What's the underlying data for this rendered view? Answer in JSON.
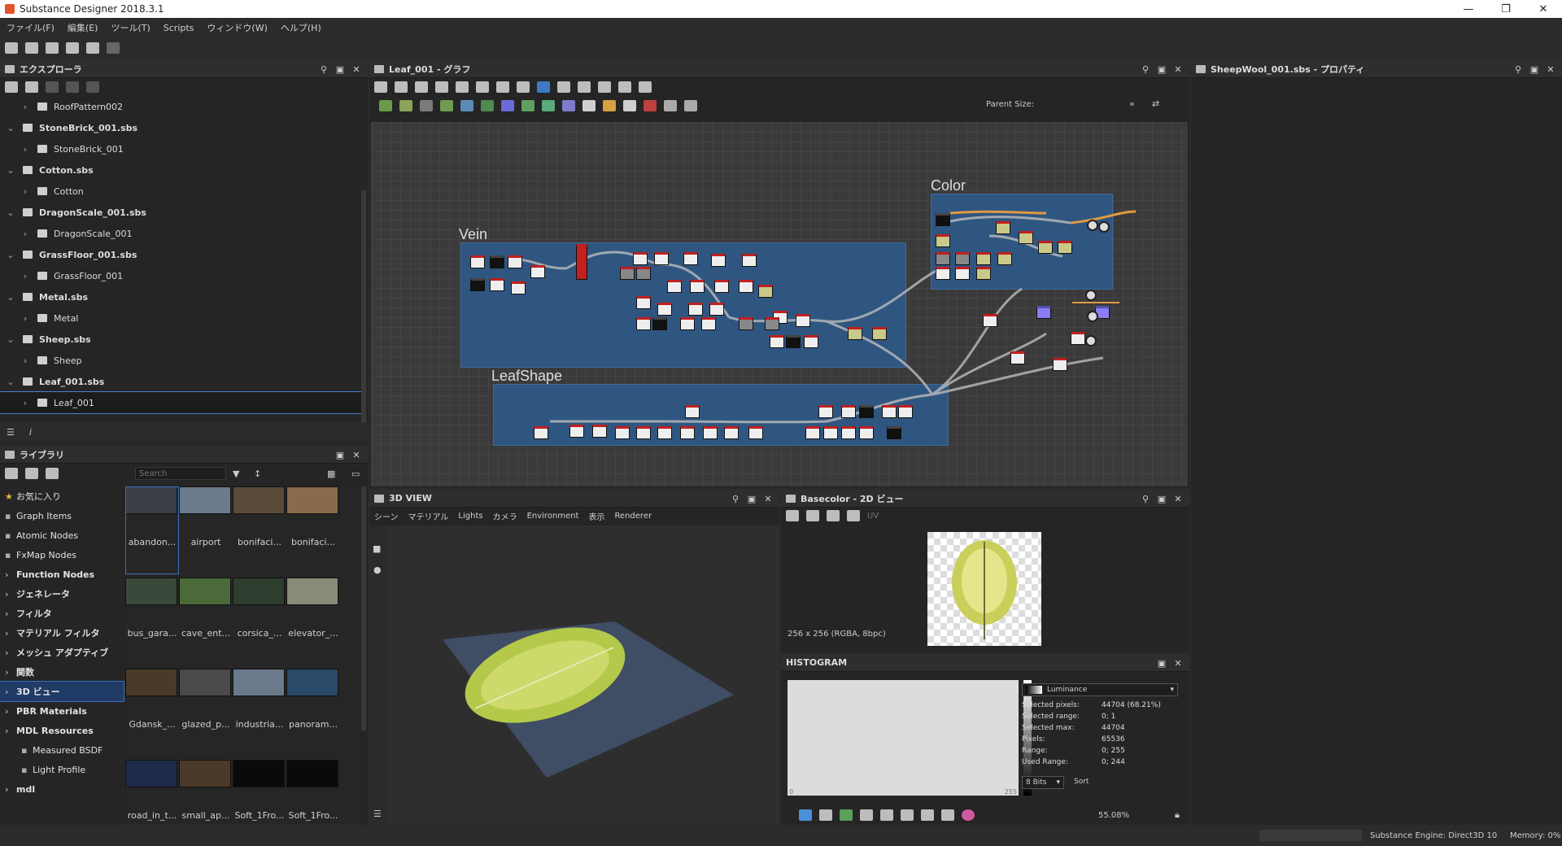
{
  "window": {
    "title": "Substance Designer 2018.3.1"
  },
  "menu": [
    "ファイル(F)",
    "編集(E)",
    "ツール(T)",
    "Scripts",
    "ウィンドウ(W)",
    "ヘルプ(H)"
  ],
  "explorer": {
    "title": "エクスプローラ",
    "rows": [
      {
        "label": "RoofPattern002",
        "level": 2,
        "expanded": false
      },
      {
        "label": "StoneBrick_001.sbs",
        "level": 1,
        "expanded": true
      },
      {
        "label": "StoneBrick_001",
        "level": 2,
        "expanded": false
      },
      {
        "label": "Cotton.sbs",
        "level": 1,
        "expanded": true
      },
      {
        "label": "Cotton",
        "level": 2,
        "expanded": false
      },
      {
        "label": "DragonScale_001.sbs",
        "level": 1,
        "expanded": true
      },
      {
        "label": "DragonScale_001",
        "level": 2,
        "expanded": false
      },
      {
        "label": "GrassFloor_001.sbs",
        "level": 1,
        "expanded": true
      },
      {
        "label": "GrassFloor_001",
        "level": 2,
        "expanded": false
      },
      {
        "label": "Metal.sbs",
        "level": 1,
        "expanded": true
      },
      {
        "label": "Metal",
        "level": 2,
        "expanded": false
      },
      {
        "label": "Sheep.sbs",
        "level": 1,
        "expanded": true
      },
      {
        "label": "Sheep",
        "level": 2,
        "expanded": false
      },
      {
        "label": "Leaf_001.sbs",
        "level": 1,
        "expanded": true
      },
      {
        "label": "Leaf_001",
        "level": 2,
        "expanded": false,
        "selected": true
      }
    ]
  },
  "library": {
    "title": "ライブラリ",
    "search_placeholder": "Search",
    "categories": [
      {
        "label": "お気に入り",
        "arrow": false,
        "bold": false
      },
      {
        "label": "Graph Items",
        "arrow": false,
        "bold": false
      },
      {
        "label": "Atomic Nodes",
        "arrow": false,
        "bold": false
      },
      {
        "label": "FxMap Nodes",
        "arrow": false,
        "bold": false
      },
      {
        "label": "Function Nodes",
        "arrow": true,
        "bold": true
      },
      {
        "label": "ジェネレータ",
        "arrow": true,
        "bold": true
      },
      {
        "label": "フィルタ",
        "arrow": true,
        "bold": true
      },
      {
        "label": "マテリアル フィルタ",
        "arrow": true,
        "bold": true
      },
      {
        "label": "メッシュ アダプティブ",
        "arrow": true,
        "bold": true
      },
      {
        "label": "関数",
        "arrow": true,
        "bold": true
      },
      {
        "label": "3D ビュー",
        "arrow": true,
        "bold": true,
        "selected": true
      },
      {
        "label": "PBR Materials",
        "arrow": true,
        "bold": true
      },
      {
        "label": "MDL Resources",
        "arrow": true,
        "bold": true
      },
      {
        "label": "Measured BSDF",
        "arrow": false,
        "bold": false,
        "indent": true
      },
      {
        "label": "Light Profile",
        "arrow": false,
        "bold": false,
        "indent": true
      },
      {
        "label": "mdl",
        "arrow": true,
        "bold": true
      }
    ],
    "thumbnails": [
      "abandon...",
      "airport",
      "bonifaci...",
      "bonifaci...",
      "bus_gara...",
      "cave_ent...",
      "corsica_...",
      "elevator_...",
      "Gdansk_...",
      "glazed_p...",
      "industria...",
      "panoram...",
      "road_in_t...",
      "small_ap...",
      "Soft_1Fro...",
      "Soft_1Fro..."
    ]
  },
  "graph": {
    "title": "Leaf_001 - グラフ",
    "parent_size_label": "Parent Size:",
    "frames": [
      "Vein",
      "LeafShape",
      "Color"
    ]
  },
  "properties": {
    "title": "SheepWool_001.sbs - プロパティ"
  },
  "view3d": {
    "title": "3D VIEW",
    "menu": [
      "シーン",
      "マテリアル",
      "Lights",
      "カメラ",
      "Environment",
      "表示",
      "Renderer"
    ]
  },
  "view2d": {
    "title": "Basecolor - 2D ビュー",
    "uv_label": "UV",
    "image_info": "256 x 256 (RGBA, 8bpc)",
    "zoom": "55.08%"
  },
  "histogram": {
    "title": "HISTOGRAM",
    "channel": "Luminance",
    "bits": "8 Bits",
    "sort_label": "Sort",
    "stats": [
      {
        "k": "Selected pixels:",
        "v": "44704 (68.21%)"
      },
      {
        "k": "Selected range:",
        "v": "0; 1"
      },
      {
        "k": "Selected max:",
        "v": "44704"
      },
      {
        "k": "Pixels:",
        "v": "65536"
      },
      {
        "k": "Range:",
        "v": "0; 255"
      },
      {
        "k": "Used Range:",
        "v": "0; 244"
      }
    ],
    "axis_min": "0",
    "axis_max": "255"
  },
  "status": {
    "engine": "Substance Engine: Direct3D 10",
    "memory": "Memory: 0%"
  }
}
